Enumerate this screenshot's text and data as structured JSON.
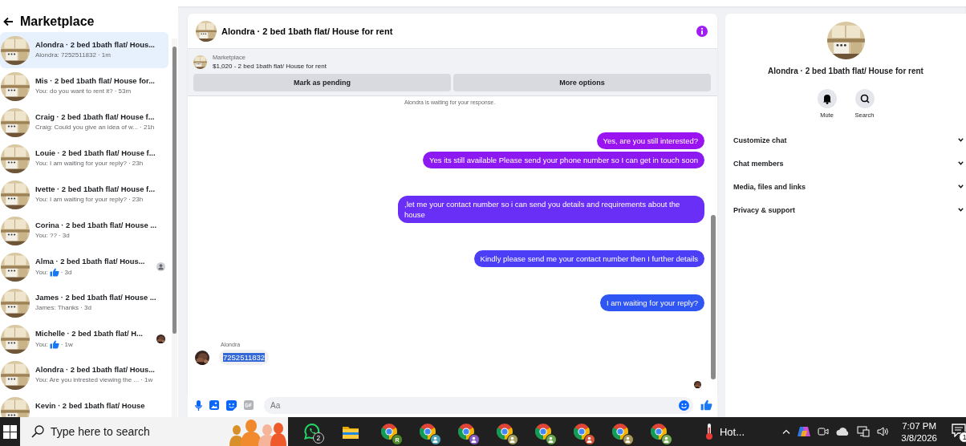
{
  "sidebar": {
    "title": "Marketplace",
    "conversations": [
      {
        "title": "Alondra · 2 bed 1bath flat/ Hous...",
        "preview": "Alondra: 7252511832",
        "time": "· 1m",
        "selected": true,
        "liked": false
      },
      {
        "title": "Mis · 2 bed 1bath flat/ House for...",
        "preview": "You: do you want to rent it?",
        "time": "· 53m",
        "selected": false,
        "liked": false
      },
      {
        "title": "Craig · 2 bed 1bath flat/ House f...",
        "preview": "Craig: Could you give an idea of w...",
        "time": "· 21h",
        "selected": false,
        "liked": false
      },
      {
        "title": "Louie · 2 bed 1bath flat/ House f...",
        "preview": "You: I am waiting for your reply?",
        "time": "· 23h",
        "selected": false,
        "liked": false
      },
      {
        "title": "Ivette · 2 bed 1bath flat/ House f...",
        "preview": "You: I am waiting for your reply?",
        "time": "· 23h",
        "selected": false,
        "liked": false
      },
      {
        "title": "Corina · 2 bed 1bath flat/ House ...",
        "preview": "You: ??",
        "time": "· 3d",
        "selected": false,
        "liked": false
      },
      {
        "title": "Alma · 2 bed 1bath flat/ Hous...",
        "preview": "You:",
        "time": "· 3d",
        "selected": false,
        "liked": true,
        "receipt": {
          "kind": "person"
        }
      },
      {
        "title": "James · 2 bed 1bath flat/ House ...",
        "preview": "James: Thanks",
        "time": "· 3d",
        "selected": false,
        "liked": false
      },
      {
        "title": "Michelle · 2 bed 1bath flat/ H...",
        "preview": "You:",
        "time": "· 1w",
        "selected": false,
        "liked": true,
        "receipt": {
          "kind": "avatar"
        }
      },
      {
        "title": "Alondra · 2 bed 1bath flat/ Hous...",
        "preview": "You: Are you intrested viewing the ...",
        "time": "· 1w",
        "selected": false,
        "liked": false
      },
      {
        "title": "Kevin · 2 bed 1bath flat/ House",
        "selected": false
      }
    ]
  },
  "chat": {
    "title": "Alondra · 2 bed 1bath flat/ House for rent",
    "listing": {
      "label": "Marketplace",
      "summary": "$1,020 - 2 bed 1bath flat/ House for rent",
      "buttons": [
        "Mark as pending",
        "More options"
      ]
    },
    "status": "Alondra is waiting for your response.",
    "message_groups": [
      {
        "kind": "outgoing",
        "messages": [
          {
            "text": "Yes, are you still interested?",
            "color": "#9a14f2",
            "highlighted": false
          },
          {
            "text": "Yes its still available Please send your phone number so I can get in touch soon",
            "color": "#8c18f2",
            "highlighted": false
          }
        ]
      },
      {
        "kind": "outgoing",
        "messages": [
          {
            "text": ",let me your contact number so i can send you details and requirements about the house",
            "color": "#6a2ff6",
            "highlighted": false
          }
        ]
      },
      {
        "kind": "outgoing",
        "messages": [
          {
            "text": "Kindly please send me your contact number then I further details",
            "color": "#4b3ef6",
            "highlighted": false
          }
        ]
      },
      {
        "kind": "outgoing",
        "messages": [
          {
            "text": "I am waiting for your reply?",
            "color": "#2f55f2",
            "highlighted": false
          }
        ]
      },
      {
        "kind": "incoming",
        "sender": "Alondra",
        "messages": [
          {
            "text": "7252511832",
            "color": "#f0f0f0",
            "highlighted": true
          }
        ]
      }
    ],
    "composer": {
      "placeholder": "Aa"
    }
  },
  "info": {
    "title": "Alondra · 2 bed 1bath flat/ House for rent",
    "actions": [
      {
        "label": "Mute",
        "kind": "mute"
      },
      {
        "label": "Search",
        "kind": "search"
      }
    ],
    "sections": [
      {
        "label": "Customize chat",
        "expanded": false
      },
      {
        "label": "Chat members",
        "expanded": false
      },
      {
        "label": "Media, files and links",
        "expanded": false
      },
      {
        "label": "Privacy & support",
        "expanded": false
      }
    ]
  },
  "taskbar": {
    "search": {
      "placeholder": "Type here to search"
    },
    "apps": [
      {
        "kind": "whatsapp",
        "badge": "2"
      },
      {
        "kind": "explorer"
      },
      {
        "kind": "chrome",
        "color": "#4f8a2b",
        "letter": "R"
      },
      {
        "kind": "chrome",
        "color": "#4fa3b5"
      },
      {
        "kind": "chrome",
        "color": "#8a5cc8"
      },
      {
        "kind": "chrome",
        "color": "#a8a060"
      },
      {
        "kind": "chrome",
        "color": "#6aa84f"
      },
      {
        "kind": "chrome",
        "color": "#d9573b"
      },
      {
        "kind": "chrome",
        "color": "#a89a5a"
      },
      {
        "kind": "chrome",
        "color": "#7aae5a"
      }
    ],
    "weather": "Hot...",
    "time": "7:07 PM",
    "date": "3/8/2026",
    "notifications": "1"
  }
}
